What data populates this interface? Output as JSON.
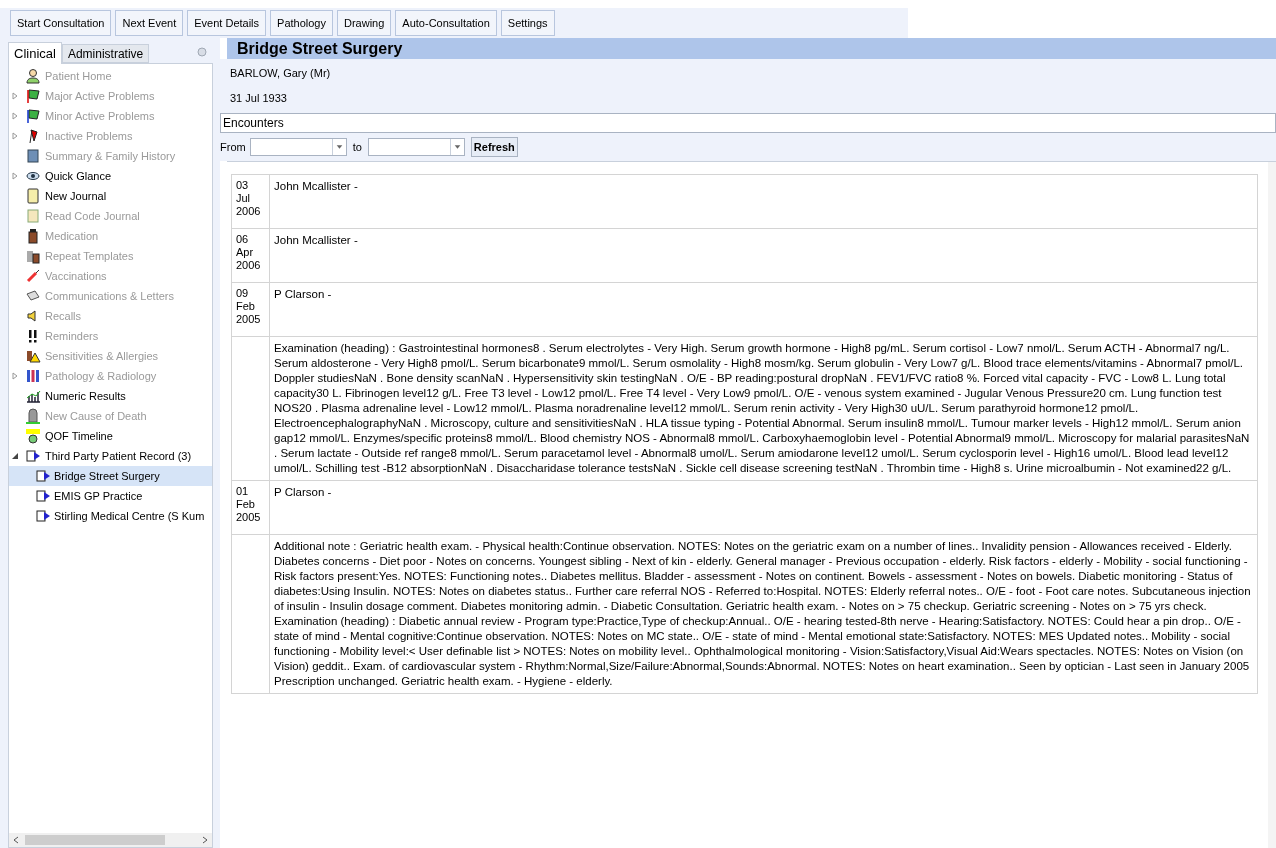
{
  "toolbar": [
    "Start Consultation",
    "Next Event",
    "Event Details",
    "Pathology",
    "Drawing",
    "Auto-Consultation",
    "Settings"
  ],
  "sidebar": {
    "tabs": [
      {
        "label": "Clinical",
        "selected": true
      },
      {
        "label": "Administrative",
        "selected": false
      }
    ],
    "items": [
      {
        "label": "Patient Home",
        "enabled": false,
        "expandable": false
      },
      {
        "label": "Major Active Problems",
        "enabled": false,
        "expandable": true,
        "expanded": false
      },
      {
        "label": "Minor Active Problems",
        "enabled": false,
        "expandable": true,
        "expanded": false
      },
      {
        "label": "Inactive Problems",
        "enabled": false,
        "expandable": true,
        "expanded": false
      },
      {
        "label": "Summary & Family History",
        "enabled": false,
        "expandable": false
      },
      {
        "label": "Quick Glance",
        "enabled": true,
        "expandable": true,
        "expanded": false
      },
      {
        "label": "New Journal",
        "enabled": true,
        "expandable": false
      },
      {
        "label": "Read Code Journal",
        "enabled": false,
        "expandable": false
      },
      {
        "label": "Medication",
        "enabled": false,
        "expandable": false
      },
      {
        "label": "Repeat Templates",
        "enabled": false,
        "expandable": false
      },
      {
        "label": "Vaccinations",
        "enabled": false,
        "expandable": false
      },
      {
        "label": "Communications & Letters",
        "enabled": false,
        "expandable": false
      },
      {
        "label": "Recalls",
        "enabled": false,
        "expandable": false
      },
      {
        "label": "Reminders",
        "enabled": false,
        "expandable": false
      },
      {
        "label": "Sensitivities & Allergies",
        "enabled": false,
        "expandable": false
      },
      {
        "label": "Pathology & Radiology",
        "enabled": false,
        "expandable": true,
        "expanded": false
      },
      {
        "label": "Numeric Results",
        "enabled": true,
        "expandable": false
      },
      {
        "label": "New Cause of Death",
        "enabled": false,
        "expandable": false
      },
      {
        "label": "QOF Timeline",
        "enabled": true,
        "expandable": false
      },
      {
        "label": "Third Party Patient Record (3)",
        "enabled": true,
        "expandable": true,
        "expanded": true,
        "children": [
          {
            "label": "Bridge Street Surgery",
            "selected": true
          },
          {
            "label": "EMIS GP Practice",
            "selected": false
          },
          {
            "label": "Stirling Medical Centre (S Kum",
            "selected": false
          }
        ]
      }
    ]
  },
  "header": {
    "title": "Bridge Street Surgery",
    "patient": "BARLOW, Gary (Mr)",
    "dob": "31 Jul 1933"
  },
  "view_select": {
    "value": "Encounters"
  },
  "filter": {
    "from_label": "From",
    "to_label": "to",
    "refresh": "Refresh"
  },
  "encounters": [
    {
      "kind": "header",
      "date": "03 Jul 2006",
      "author": "John Mcallister -"
    },
    {
      "kind": "header",
      "date": "06 Apr 2006",
      "author": "John Mcallister -"
    },
    {
      "kind": "header",
      "date": "09 Feb 2005",
      "author": "P Clarson -"
    },
    {
      "kind": "note",
      "paragraphs": [
        "Examination (heading) : Gastrointestinal hormones8 . Serum electrolytes - Very High. Serum growth hormone - High8 pg/mL. Serum cortisol - Low7 nmol/L. Serum ACTH - Abnormal7 ng/L. Serum aldosterone - Very High8 pmol/L. Serum bicarbonate9 mmol/L. Serum osmolality - High8 mosm/kg. Serum globulin - Very Low7 g/L. Blood trace elements/vitamins - Abnormal7 pmol/L. Doppler studiesNaN . Bone density scanNaN . Hypersensitivity skin testingNaN . O/E - BP reading:postural dropNaN . FEV1/FVC ratio8 %. Forced vital capacity - FVC - Low8 L. Lung total capacity30 L. Fibrinogen level12 g/L. Free T3 level - Low12 pmol/L. Free T4 level - Very Low9 pmol/L. O/E - venous system examined - Jugular Venous Pressure20 cm. Lung function test NOS20 . Plasma adrenaline level - Low12 mmol/L. Plasma noradrenaline level12 mmol/L. Serum renin activity - Very High30 uU/L. Serum parathyroid hormone12 pmol/L. ElectroencephalographyNaN . Microscopy, culture and sensitivitiesNaN . HLA tissue typing - Potential Abnormal. Serum insulin8 mmol/L. Tumour marker levels - High12 mmol/L. Serum anion gap12 mmol/L. Enzymes/specific proteins8 mmol/L. Blood chemistry NOS - Abnormal8 mmol/L. Carboxyhaemoglobin level - Potential Abnormal9 mmol/L. Microscopy for malarial parasitesNaN . Serum lactate - Outside ref range8 mmol/L. Serum paracetamol level - Abnormal8 umol/L. Serum amiodarone level12 umol/L. Serum cyclosporin level - High16 umol/L. Blood lead level12 umol/L. Schilling test -B12 absorptionNaN . Disaccharidase tolerance testsNaN . Sickle cell disease screening testNaN . Thrombin time - High8 s. Urine microalbumin - Not examined22 g/L."
      ]
    },
    {
      "kind": "header",
      "date": "01 Feb 2005",
      "author": "P Clarson -"
    },
    {
      "kind": "note",
      "paragraphs": [
        "Additional note : Geriatric health exam. - Physical health:Continue observation. NOTES: Notes on the geriatric exam on a number of lines.. Invalidity pension - Allowances received - Elderly. Diabetes concerns - Diet poor - Notes on concerns. Youngest sibling - Next of kin - elderly. General manager - Previous occupation - elderly. Risk factors - elderly - Mobility - social functioning - Risk factors present:Yes. NOTES: Functioning notes.. Diabetes mellitus. Bladder - assessment - Notes on continent. Bowels - assessment - Notes on bowels. Diabetic monitoring - Status of diabetes:Using Insulin. NOTES: Notes on diabetes status.. Further care referral NOS - Referred to:Hospital. NOTES: Elderly referral notes.. O/E - foot - Foot care notes. Subcutaneous injection of insulin - Insulin dosage comment. Diabetes monitoring admin. - Diabetic Consultation. Geriatric health exam. - Notes on > 75 checkup. Geriatric screening - Notes on > 75 yrs check.",
        "Examination (heading) : Diabetic annual review - Program type:Practice,Type of checkup:Annual.. O/E - hearing tested-8th nerve - Hearing:Satisfactory. NOTES: Could hear a pin drop.. O/E - state of mind - Mental cognitive:Continue observation. NOTES: Notes on MC state.. O/E - state of mind - Mental emotional state:Satisfactory. NOTES: MES Updated notes.. Mobility - social functioning - Mobility level:< User definable list > NOTES: Notes on mobility level.. Ophthalmological monitoring - Vision:Satisfactory,Visual Aid:Wears spectacles. NOTES: Notes on Vision (on Vision) geddit.. Exam. of cardiovascular system - Rhythm:Normal,Size/Failure:Abnormal,Sounds:Abnormal. NOTES: Notes on heart examination.. Seen by optician - Last seen in January 2005 Prescription unchanged. Geriatric health exam. - Hygiene - elderly."
      ]
    }
  ]
}
